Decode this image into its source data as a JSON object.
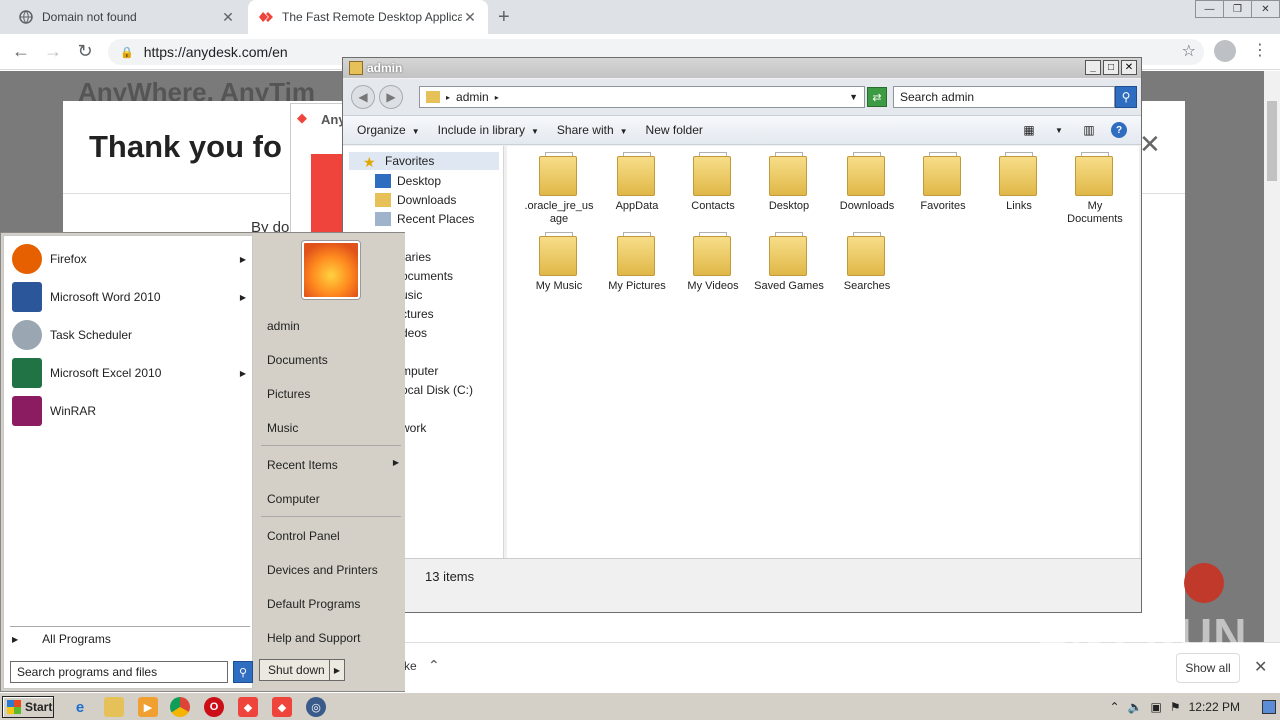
{
  "browser": {
    "tabs": [
      {
        "title": "Domain not found",
        "active": false
      },
      {
        "title": "The Fast Remote Desktop Applicatio",
        "active": true
      }
    ],
    "url": "https://anydesk.com/en",
    "page": {
      "background_heading": "AnyWhere, AnyTim",
      "modal_heading": "Thank you fo",
      "byline": "By do",
      "popup_label": "Any"
    },
    "download_bar": {
      "partial_text": "ke",
      "show_all": "Show all"
    },
    "watermark": "ANY.RUN"
  },
  "explorer": {
    "title": "admin",
    "breadcrumb": "admin",
    "search_placeholder": "Search admin",
    "commands": [
      "Organize",
      "Include in library",
      "Share with",
      "New folder"
    ],
    "nav": {
      "favorites": "Favorites",
      "items": [
        "Desktop",
        "Downloads",
        "Recent Places"
      ],
      "cut_items": [
        "raries",
        "ocuments",
        "usic",
        "ctures",
        "deos",
        "mputer",
        "ocal Disk (C:)",
        "work"
      ]
    },
    "folders": [
      {
        "name": ".oracle_jre_usage",
        "icon": "folder-icon"
      },
      {
        "name": "AppData",
        "icon": "folder-icon"
      },
      {
        "name": "Contacts",
        "icon": "contacts-folder-icon"
      },
      {
        "name": "Desktop",
        "icon": "desktop-folder-icon"
      },
      {
        "name": "Downloads",
        "icon": "downloads-folder-icon"
      },
      {
        "name": "Favorites",
        "icon": "favorites-folder-icon"
      },
      {
        "name": "Links",
        "icon": "links-folder-icon"
      },
      {
        "name": "My Documents",
        "icon": "documents-folder-icon"
      },
      {
        "name": "My Music",
        "icon": "music-folder-icon"
      },
      {
        "name": "My Pictures",
        "icon": "pictures-folder-icon"
      },
      {
        "name": "My Videos",
        "icon": "videos-folder-icon"
      },
      {
        "name": "Saved Games",
        "icon": "games-folder-icon"
      },
      {
        "name": "Searches",
        "icon": "searches-folder-icon"
      }
    ],
    "status": "13 items"
  },
  "start_menu": {
    "programs": [
      {
        "label": "Firefox",
        "has_submenu": true,
        "color": "#e66000"
      },
      {
        "label": "Microsoft Word 2010",
        "has_submenu": true,
        "color": "#2b579a"
      },
      {
        "label": "Task Scheduler",
        "has_submenu": false,
        "color": "#9aa6b2"
      },
      {
        "label": "Microsoft Excel 2010",
        "has_submenu": true,
        "color": "#217346"
      },
      {
        "label": "WinRAR",
        "has_submenu": false,
        "color": "#8b1c62"
      }
    ],
    "all_programs": "All Programs",
    "search_placeholder": "Search programs and files",
    "right_items": {
      "admin": "admin",
      "documents": "Documents",
      "pictures": "Pictures",
      "music": "Music",
      "recent_items": "Recent Items",
      "computer": "Computer",
      "control_panel": "Control Panel",
      "devices_printers": "Devices and Printers",
      "default_programs": "Default Programs",
      "help_support": "Help and Support"
    },
    "shutdown": "Shut down"
  },
  "taskbar": {
    "start_label": "Start",
    "clock": "12:22 PM"
  }
}
